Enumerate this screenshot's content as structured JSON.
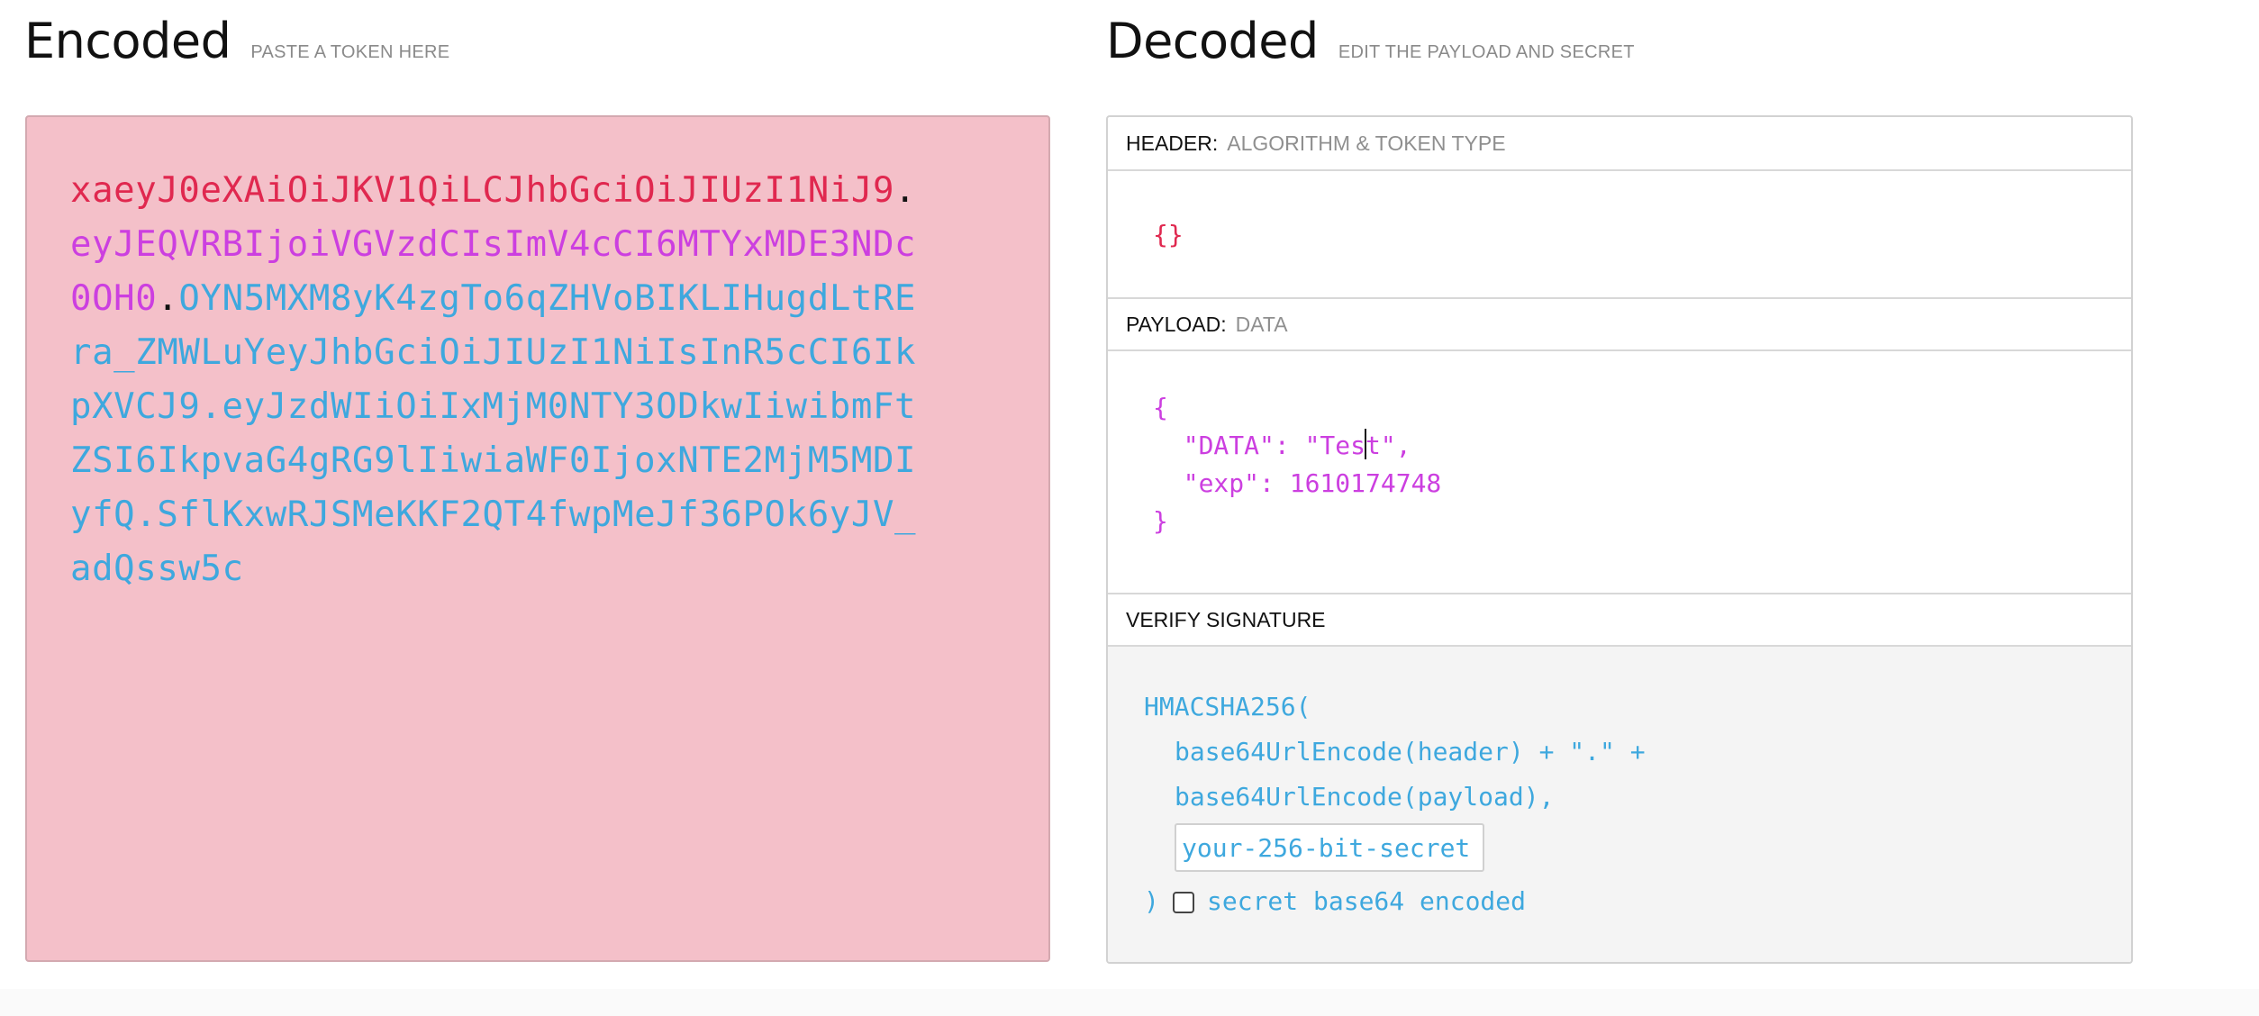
{
  "encoded": {
    "title": "Encoded",
    "subtitle": "PASTE A TOKEN HERE",
    "token_header": "xaeyJ0eXAiOiJKV1QiLCJhbGciOiJIUzI1NiJ9",
    "token_payload": "eyJEQVRBIjoiVGVzdCIsImV4cCI6MTYxMDE3NDc0OH0",
    "token_signature": "OYN5MXM8yK4zgTo6qZHVoBIKLIHugdLtREra_ZMWLuYeyJhbGciOiJIUzI1NiIsInR5cCI6IkpXVCJ9.eyJzdWIiOiIxMjM0NTY3ODkwIiwibmFtZSI6IkpvaG4gRG9lIiwiaWF0IjoxNTE2MjM5MDIyfQ.SflKxwRJSMeKKF2QT4fwpMeJf36POk6yJV_adQssw5c",
    "dot": "."
  },
  "decoded": {
    "title": "Decoded",
    "subtitle": "EDIT THE PAYLOAD AND SECRET",
    "header_label": "HEADER:",
    "header_sub": "ALGORITHM & TOKEN TYPE",
    "header_json": "{}",
    "payload_label": "PAYLOAD:",
    "payload_sub": "DATA",
    "payload_open": "{",
    "payload_line1_pre": "  \"DATA\": \"Tes",
    "payload_line1_post": "t\",",
    "payload_line2": "  \"exp\": 1610174748",
    "payload_close": "}",
    "verify_label": "VERIFY SIGNATURE",
    "verify_line1": "HMACSHA256(",
    "verify_line2": "base64UrlEncode(header) + \".\" +",
    "verify_line3": "base64UrlEncode(payload),",
    "secret_placeholder": "your-256-bit-secret",
    "verify_close": ")",
    "base64_label": "secret base64 encoded"
  },
  "colors": {
    "header": "#e0284f",
    "payload": "#cc3fe0",
    "signature": "#3ea8de",
    "encoded_bg": "#f4c0c9"
  }
}
